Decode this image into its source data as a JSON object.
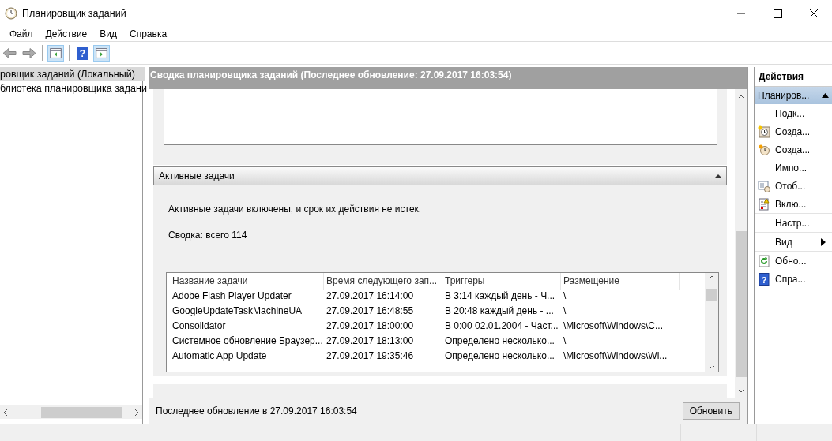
{
  "window": {
    "title": "Планировщик заданий"
  },
  "menu": [
    "Файл",
    "Действие",
    "Вид",
    "Справка"
  ],
  "toolbar": {
    "help_glyph": "?"
  },
  "tree": {
    "items": [
      {
        "label": "ровщик заданий (Локальный)",
        "selected": true
      },
      {
        "label": "блиотека планировщика задани",
        "selected": false
      }
    ]
  },
  "summary": {
    "header": "Сводка планировщика заданий (Последнее обновление: 27.09.2017 16:03:54)",
    "section_title": "Активные задачи",
    "section_expanded": true,
    "description": "Активные задачи включены, и срок их действия не истек.",
    "total": "Сводка: всего 114",
    "table": {
      "columns": [
        "Название задачи",
        "Время следующего зап...",
        "Триггеры",
        "Размещение"
      ],
      "rows": [
        [
          "Adobe Flash Player Updater",
          "27.09.2017 16:14:00",
          "В 3:14 каждый день - Ч...",
          "\\"
        ],
        [
          "GoogleUpdateTaskMachineUA",
          "27.09.2017 16:48:55",
          "В 20:48 каждый день - ...",
          "\\"
        ],
        [
          "Consolidator",
          "27.09.2017 18:00:00",
          "В 0:00 02.01.2004 - Част...",
          "\\Microsoft\\Windows\\C..."
        ],
        [
          "Системное обновление Браузер...",
          "27.09.2017 18:13:00",
          "Определено несколько...",
          "\\"
        ],
        [
          "Automatic App Update",
          "27.09.2017 19:35:46",
          "Определено несколько...",
          "\\Microsoft\\Windows\\Wi..."
        ]
      ]
    },
    "footer": "Последнее обновление в 27.09.2017 16:03:54",
    "refresh_button": "Обновить"
  },
  "actions": {
    "title": "Действия",
    "group": {
      "label": "Планиров...",
      "expanded": true
    },
    "items": [
      {
        "label": "Подк...",
        "kind": "plain",
        "divider_above": false
      },
      {
        "label": "Созда...",
        "kind": "task",
        "divider_above": false
      },
      {
        "label": "Созда...",
        "kind": "clock",
        "divider_above": false
      },
      {
        "label": "Импо...",
        "kind": "plain",
        "divider_above": false
      },
      {
        "label": "Отоб...",
        "kind": "display",
        "divider_above": false
      },
      {
        "label": "Вклю...",
        "kind": "log",
        "divider_above": false
      },
      {
        "label": "Настр...",
        "kind": "plain",
        "divider_above": true
      },
      {
        "label": "Вид",
        "kind": "submenu",
        "divider_above": true
      },
      {
        "label": "Обно...",
        "kind": "refresh",
        "divider_above": true
      },
      {
        "label": "Спра...",
        "kind": "help",
        "divider_above": false,
        "glyph": "?"
      }
    ]
  }
}
